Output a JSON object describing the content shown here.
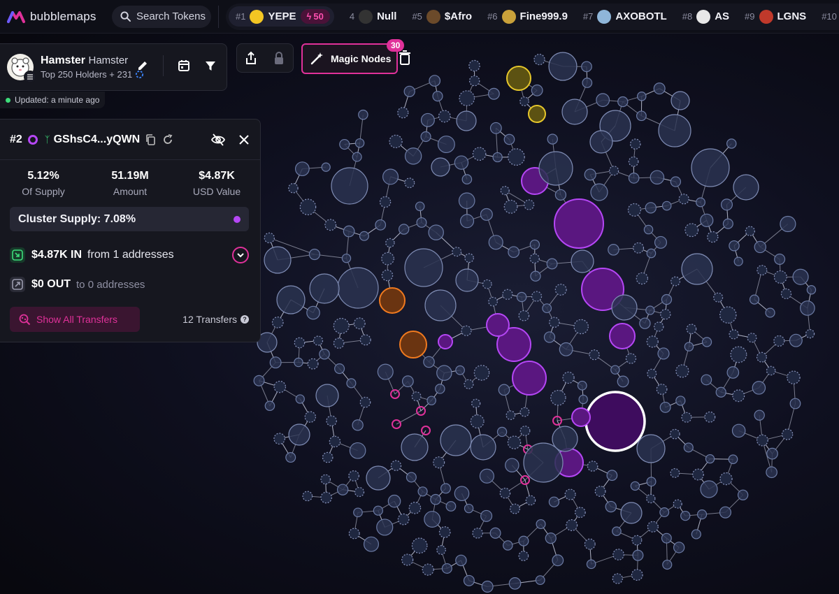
{
  "app": {
    "name": "bubblemaps"
  },
  "search": {
    "placeholder": "Search Tokens"
  },
  "ticker": [
    {
      "rank": "#1",
      "name": "YEPE",
      "badge": "50",
      "color": "#f3c623"
    },
    {
      "rank": "4",
      "name": "Null",
      "color": "#333333"
    },
    {
      "rank": "#5",
      "name": "$Afro",
      "color": "#6b4a2a"
    },
    {
      "rank": "#6",
      "name": "Fine999.9",
      "color": "#c9a13a"
    },
    {
      "rank": "#7",
      "name": "AXOBOTL",
      "color": "#8fb6d9"
    },
    {
      "rank": "#8",
      "name": "AS",
      "color": "#e8e8e8"
    },
    {
      "rank": "#9",
      "name": "LGNS",
      "color": "#c0392b"
    },
    {
      "rank": "#10",
      "name": "",
      "color": "#888888"
    }
  ],
  "token": {
    "name": "Hamster",
    "symbol": "Hamster",
    "subtitle": "Top 250 Holders + 231",
    "updated": "Updated: a minute ago"
  },
  "magic": {
    "label": "Magic Nodes",
    "count": "30"
  },
  "wallet": {
    "rank": "#2",
    "address": "GShsC4...yQWN",
    "stats": [
      {
        "value": "5.12%",
        "label": "Of Supply"
      },
      {
        "value": "51.19M",
        "label": "Amount"
      },
      {
        "value": "$4.87K",
        "label": "USD Value"
      }
    ],
    "cluster_supply": "Cluster Supply: 7.08%",
    "in": {
      "amount": "$4.87K IN",
      "desc": "from 1 addresses"
    },
    "out": {
      "amount": "$0 OUT",
      "desc": "to 0 addresses"
    },
    "show_transfers": "Show All Transfers",
    "transfer_count": "12 Transfers"
  },
  "colors": {
    "accent": "#e0319a",
    "purple": "#b547f5",
    "orange": "#f07a1f",
    "yellow": "#e6c72b",
    "node": "#2a3350",
    "node_stroke": "#6b7aa3"
  },
  "icons": [
    "search-icon",
    "pencil-icon",
    "calendar-icon",
    "filter-icon",
    "share-icon",
    "lock-icon",
    "magic-wand-icon",
    "trash-icon",
    "copy-icon",
    "refresh-icon",
    "eye-off-icon",
    "close-icon",
    "arrow-in-icon",
    "arrow-out-icon",
    "chevron-down-icon",
    "graph-search-icon",
    "help-icon"
  ]
}
